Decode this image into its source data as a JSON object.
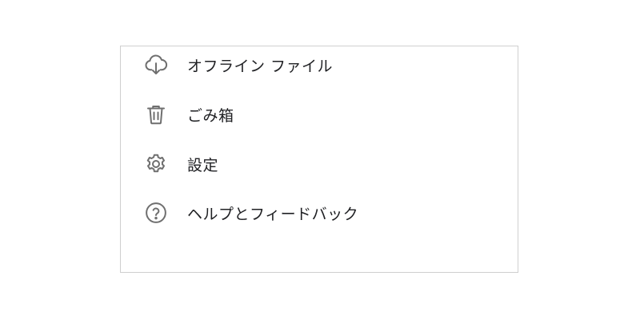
{
  "menu": {
    "items": [
      {
        "label": "オフライン ファイル",
        "icon": "cloud-download-icon"
      },
      {
        "label": "ごみ箱",
        "icon": "trash-icon"
      },
      {
        "label": "設定",
        "icon": "gear-icon"
      },
      {
        "label": "ヘルプとフィードバック",
        "icon": "help-circle-icon"
      }
    ]
  },
  "colors": {
    "icon": "#6f6f6f",
    "text": "#202124",
    "border": "#cfcfcf",
    "background": "#ffffff"
  }
}
